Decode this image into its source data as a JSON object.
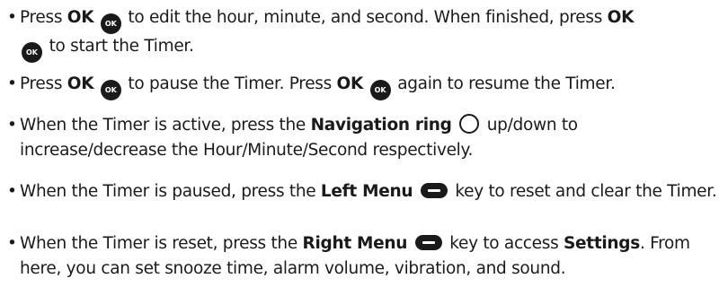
{
  "bullet": "•",
  "icons": {
    "ok_text": "OK",
    "ok_button": "ok-button-icon",
    "navigation_ring": "navigation-ring-icon",
    "menu_key": "menu-key-icon"
  },
  "items": [
    {
      "t1": "Press ",
      "b1": "OK",
      "t2": " to edit the hour, minute, and second. When finished, press ",
      "b2": "OK",
      "t3": " to start the Timer."
    },
    {
      "t1": "Press ",
      "b1": "OK",
      "t2": " to pause the Timer. Press ",
      "b2": "OK",
      "t3": " again to resume the Timer."
    },
    {
      "t1": "When the Timer is active, press the ",
      "b1": "Navigation ring",
      "t2": " up/down to increase/decrease the Hour/Minute/Second respectively."
    },
    {
      "t1": "When the Timer is paused, press the ",
      "b1": "Left Menu",
      "t2": " key to reset and clear the Timer."
    },
    {
      "t1": "When the Timer is reset, press the ",
      "b1": "Right Menu",
      "t2": " key to access ",
      "b2": "Settings",
      "t3": ". From here, you can set snooze time, alarm volume, vibration, and sound."
    }
  ]
}
